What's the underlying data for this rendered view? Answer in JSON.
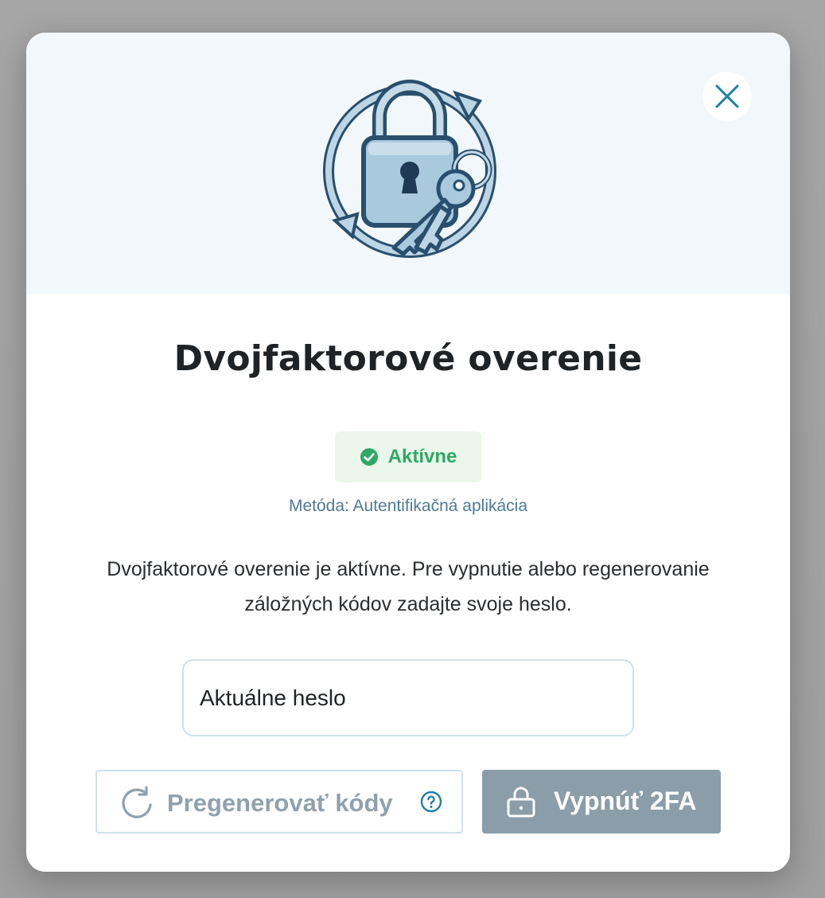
{
  "dialog": {
    "title": "Dvojfaktorové overenie",
    "status": {
      "label": "Aktívne",
      "color": "#2fa865",
      "icon": "check-circle-icon"
    },
    "method": "Metóda: Autentifikačná aplikácia",
    "description": "Dvojfaktorové overenie je aktívne. Pre vypnutie alebo regenerovanie záložných kódov zadajte svoje heslo.",
    "password": {
      "placeholder": "Aktuálne heslo",
      "value": ""
    },
    "regenerate_button": {
      "label": "Pregenerovať kódy",
      "icon": "refresh-icon",
      "help_icon": "help-icon"
    },
    "disable_button": {
      "label": "Vypnúť 2FA",
      "icon": "lock-icon"
    },
    "close_icon": "close-icon",
    "hero_icon": "padlock-keys-icon"
  },
  "colors": {
    "accent": "#1f7fa8",
    "hero_bg": "#f1f7fa",
    "disabled_button": "#8a9da9",
    "status_bg": "#eaf7ea"
  }
}
